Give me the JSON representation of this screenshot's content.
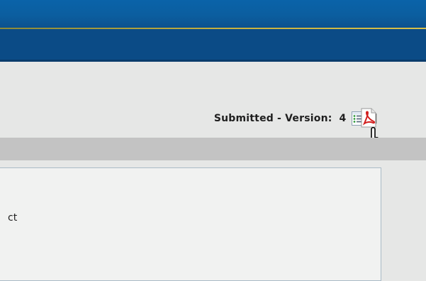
{
  "header": {
    "colors": {
      "top": "#0a63a9",
      "bottom": "#0b4b86",
      "accent_line": "#c9b23f"
    }
  },
  "status": {
    "label": "Submitted - Version:",
    "version": "4",
    "separator": "|",
    "version_list_icon": "version-list-icon",
    "pdf_icon": "pdf-icon"
  },
  "cursor": {
    "type": "hand-pointer-icon"
  },
  "content": {
    "partial_text": "ct"
  }
}
